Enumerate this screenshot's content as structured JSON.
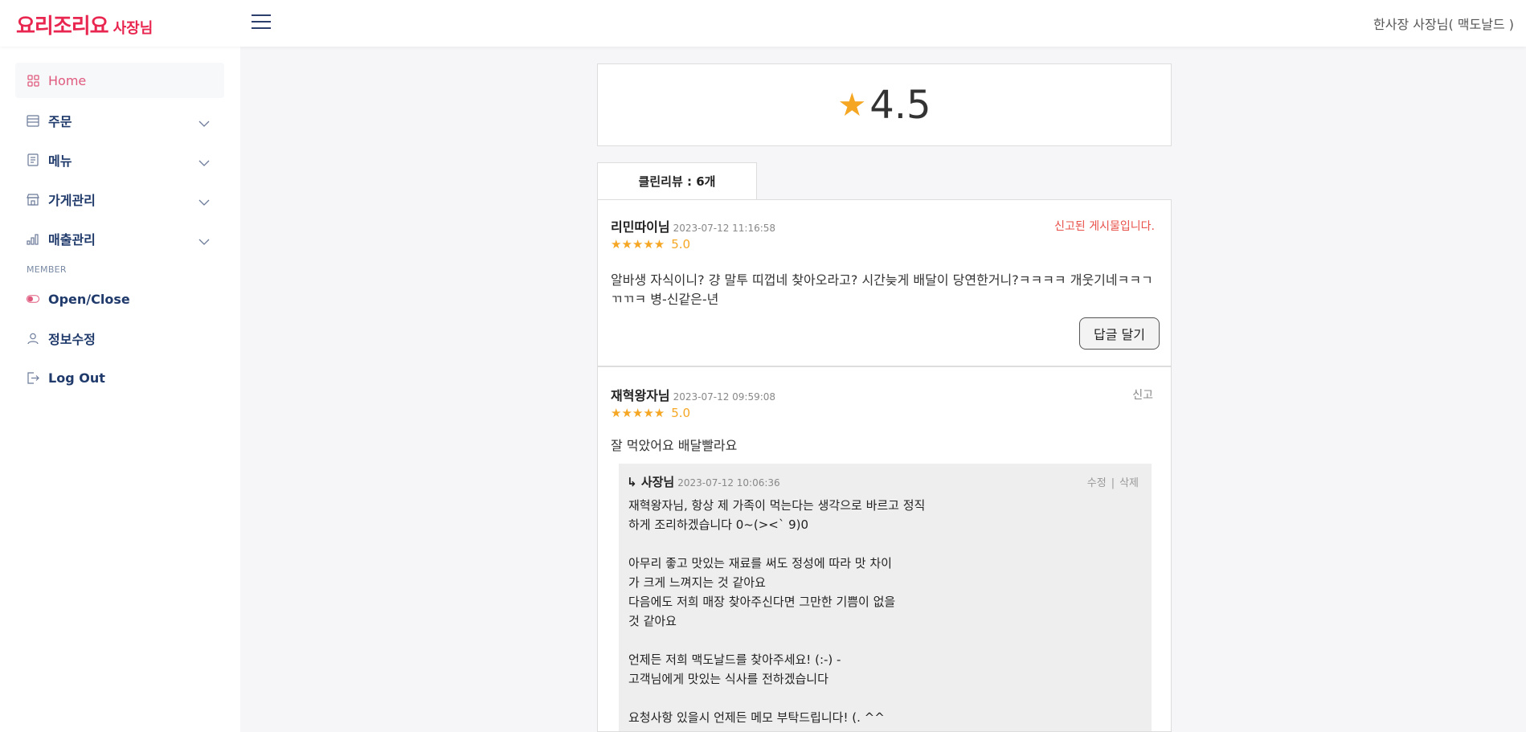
{
  "header": {
    "logo_main": "요리조리요",
    "logo_sub": "사장님",
    "user": "한사장 사장님( 맥도날드 )"
  },
  "sidebar": {
    "items": [
      {
        "label": "Home"
      },
      {
        "label": "주문"
      },
      {
        "label": "메뉴"
      },
      {
        "label": "가게관리"
      },
      {
        "label": "매출관리"
      }
    ],
    "section": "MEMBER",
    "member_items": [
      {
        "label": "Open/Close"
      },
      {
        "label": "정보수정"
      },
      {
        "label": "Log Out"
      }
    ]
  },
  "rating": {
    "star": "★",
    "value": "4.5"
  },
  "tab": {
    "label": "클린리뷰 : 6개"
  },
  "reviews": [
    {
      "name": "리민따이님",
      "date": "2023-07-12 11:16:58",
      "stars": "★★★★★",
      "score": "5.0",
      "status": "신고된 게시물입니다.",
      "text": "알바생 자식이니? 걍 말투 띠껍네 찾아오라고? 시간늦게 배달이 당연한거니?ㅋㅋㅋㅋ 개웃기네ㅋㅋㄱㄲㄲㅋ 병-신같은-년",
      "reply_button": "답글 달기"
    },
    {
      "name": "재혁왕자님",
      "date": "2023-07-12 09:59:08",
      "stars": "★★★★★",
      "score": "5.0",
      "report": "신고",
      "text": "잘 먹았어요 배달빨라요",
      "owner_reply": {
        "arrow": "↳",
        "name": "사장님",
        "date": "2023-07-12 10:06:36",
        "edit": "수정",
        "divider": "|",
        "delete": "삭제",
        "text": "재혁왕자님, 항상 제 가족이 먹는다는 생각으로 바르고 정직\n하게 조리하겠습니다 0~(><` 9)0\n\n아무리 좋고 맛있는 재료를 써도 정성에 따라 맛 차이\n가 크게 느껴지는 것 같아요\n다음에도 저희 매장 찾아주신다면 그만한 기쁨이 없을\n것 같아요\n\n언제든 저희 맥도날드를 찾아주세요! (:-) -\n고객님에게 맛있는 식사를 전하겠습니다\n\n요청사항 있을시 언제든 메모 부탁드립니다! (. ^^"
      }
    }
  ],
  "colors": {
    "brand": "#e8264f",
    "star": "#f5a623",
    "nav_text": "#1f3a6b",
    "active_nav": "#e05a7e",
    "reported": "#e8504a"
  }
}
